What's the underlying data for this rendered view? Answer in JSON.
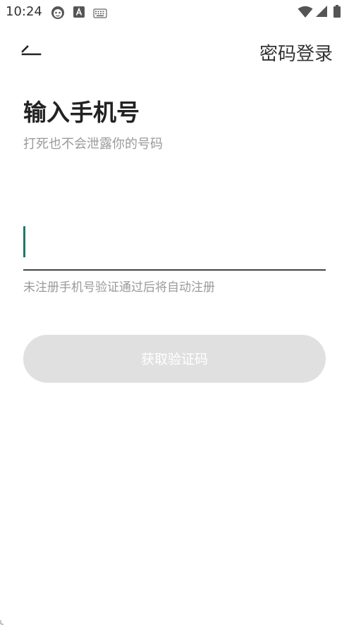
{
  "status_bar": {
    "time": "10:24",
    "icons": [
      "face-icon",
      "text-a-icon",
      "keyboard-icon",
      "wifi-icon",
      "signal-icon",
      "battery-icon"
    ]
  },
  "header": {
    "back_icon": "back-arrow-icon",
    "password_login_label": "密码登录"
  },
  "main": {
    "title": "输入手机号",
    "subtitle": "打死也不会泄露你的号码",
    "phone_input": {
      "value": "",
      "placeholder": ""
    },
    "hint": "未注册手机号验证通过后将自动注册",
    "get_code_label": "获取验证码"
  },
  "colors": {
    "accent": "#1f7a63",
    "button_disabled_bg": "#e0e0e0",
    "hint_text": "#9a9a9a"
  }
}
